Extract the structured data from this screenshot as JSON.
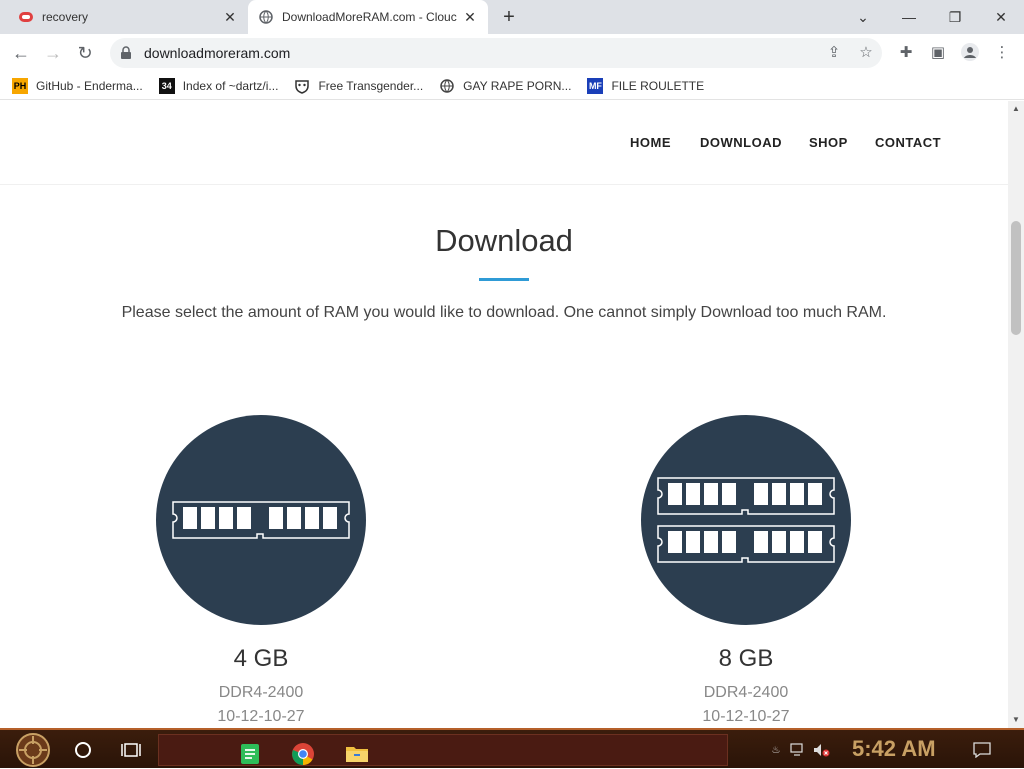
{
  "browser": {
    "tabs": [
      {
        "title": "recovery",
        "active": false
      },
      {
        "title": "DownloadMoreRAM.com - Clouc",
        "active": true
      }
    ],
    "new_tab_label": "+",
    "url": "downloadmoreram.com",
    "bookmarks": [
      {
        "label": "GitHub - Enderma...",
        "icon": "PH"
      },
      {
        "label": "Index of ~dartz/i...",
        "icon": "34"
      },
      {
        "label": "Free Transgender...",
        "icon": "mask"
      },
      {
        "label": "GAY RAPE PORN...",
        "icon": "globe"
      },
      {
        "label": "FILE ROULETTE",
        "icon": "MF"
      }
    ]
  },
  "site": {
    "nav": [
      "HOME",
      "DOWNLOAD",
      "SHOP",
      "CONTACT"
    ],
    "heading": "Download",
    "lead": "Please select the amount of RAM you would like to download. One cannot simply Download too much RAM.",
    "accent_color": "#2f9bd6",
    "products": [
      {
        "name": "4 GB",
        "spec": "DDR4-2400",
        "timing": "10-12-10-27",
        "sticks": 1
      },
      {
        "name": "8 GB",
        "spec": "DDR4-2400",
        "timing": "10-12-10-27",
        "sticks": 2
      }
    ]
  },
  "taskbar": {
    "clock": "5:42 AM"
  }
}
